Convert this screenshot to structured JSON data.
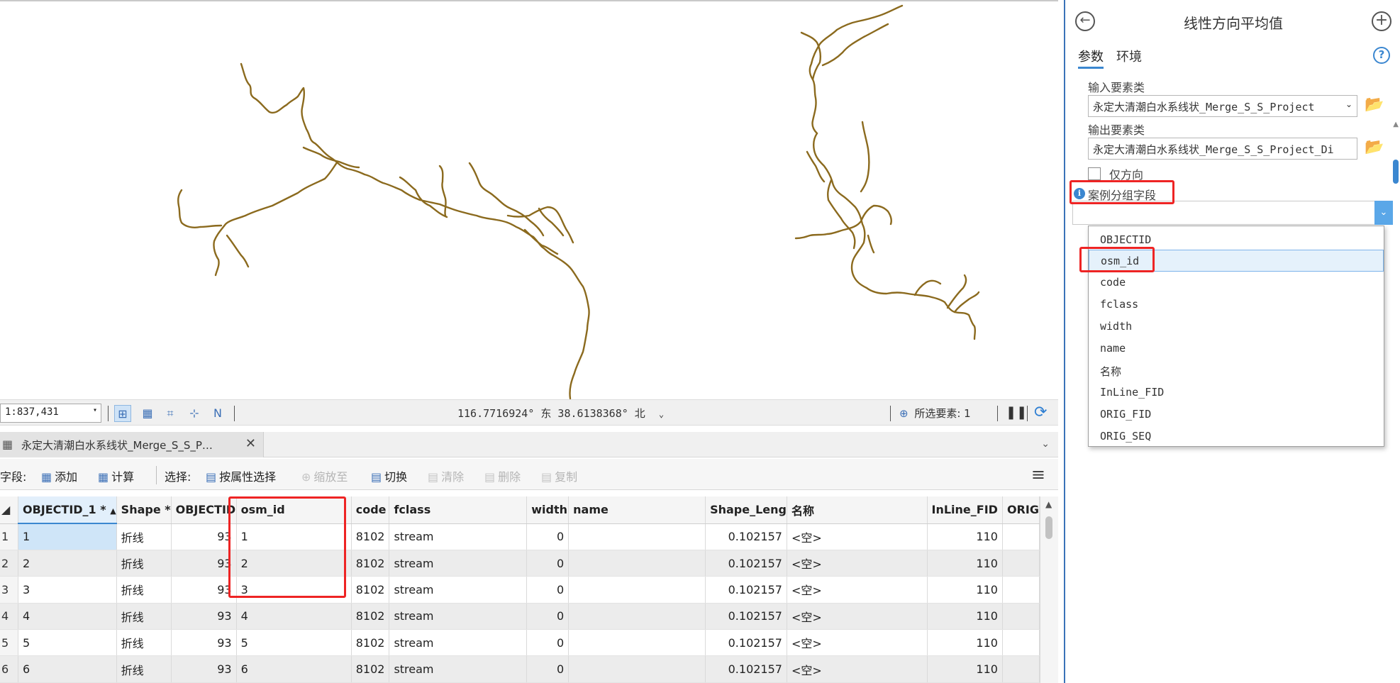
{
  "map": {
    "line_color": "#8b6a1e",
    "scale": "1:837,431",
    "coordinates": "116.7716924° 东  38.6138368° 北",
    "selected_features": "所选要素: 1"
  },
  "table_tab": {
    "title": "永定大清潮白水系线状_Merge_S_S_P…",
    "close": "✕"
  },
  "table_toolbar": {
    "field_label": "字段:",
    "add": "添加",
    "calculate": "计算",
    "select_label": "选择:",
    "select_by_attr": "按属性选择",
    "zoom_to": "缩放至",
    "switch": "切换",
    "clear": "清除",
    "delete": "删除",
    "copy": "复制"
  },
  "table": {
    "columns": [
      "OBJECTID_1 *",
      "Shape *",
      "OBJECTID",
      "osm_id",
      "code",
      "fclass",
      "width",
      "name",
      "Shape_Leng",
      "名称",
      "InLine_FID",
      "ORIG"
    ],
    "rows": [
      {
        "row": "1",
        "oid1": "1",
        "shape": "折线",
        "oid": "93",
        "osm_id": "1",
        "code": "8102",
        "fclass": "stream",
        "width": "0",
        "name": "",
        "leng": "0.102157",
        "mc": "<空>",
        "inline": "110"
      },
      {
        "row": "2",
        "oid1": "2",
        "shape": "折线",
        "oid": "93",
        "osm_id": "2",
        "code": "8102",
        "fclass": "stream",
        "width": "0",
        "name": "",
        "leng": "0.102157",
        "mc": "<空>",
        "inline": "110"
      },
      {
        "row": "3",
        "oid1": "3",
        "shape": "折线",
        "oid": "93",
        "osm_id": "3",
        "code": "8102",
        "fclass": "stream",
        "width": "0",
        "name": "",
        "leng": "0.102157",
        "mc": "<空>",
        "inline": "110"
      },
      {
        "row": "4",
        "oid1": "4",
        "shape": "折线",
        "oid": "93",
        "osm_id": "4",
        "code": "8102",
        "fclass": "stream",
        "width": "0",
        "name": "",
        "leng": "0.102157",
        "mc": "<空>",
        "inline": "110"
      },
      {
        "row": "5",
        "oid1": "5",
        "shape": "折线",
        "oid": "93",
        "osm_id": "5",
        "code": "8102",
        "fclass": "stream",
        "width": "0",
        "name": "",
        "leng": "0.102157",
        "mc": "<空>",
        "inline": "110"
      },
      {
        "row": "6",
        "oid1": "6",
        "shape": "折线",
        "oid": "93",
        "osm_id": "6",
        "code": "8102",
        "fclass": "stream",
        "width": "0",
        "name": "",
        "leng": "0.102157",
        "mc": "<空>",
        "inline": "110"
      }
    ]
  },
  "pane": {
    "title": "线性方向平均值",
    "tab_params": "参数",
    "tab_env": "环境",
    "help": "?",
    "input_label": "输入要素类",
    "input_value": "永定大清潮白水系线状_Merge_S_S_Project",
    "output_label": "输出要素类",
    "output_value": "永定大清潮白水系线状_Merge_S_S_Project_Di",
    "orientation_only": "仅方向",
    "case_field_label": "案例分组字段",
    "case_field_value": "",
    "dropdown_items": [
      "OBJECTID",
      "osm_id",
      "code",
      "fclass",
      "width",
      "name",
      "名称",
      "InLine_FID",
      "ORIG_FID",
      "ORIG_SEQ"
    ],
    "highlighted_item": "osm_id"
  },
  "colors": {
    "accent": "#3b87d0",
    "annotation_red": "#ee2424",
    "folder": "#d7a31b"
  }
}
